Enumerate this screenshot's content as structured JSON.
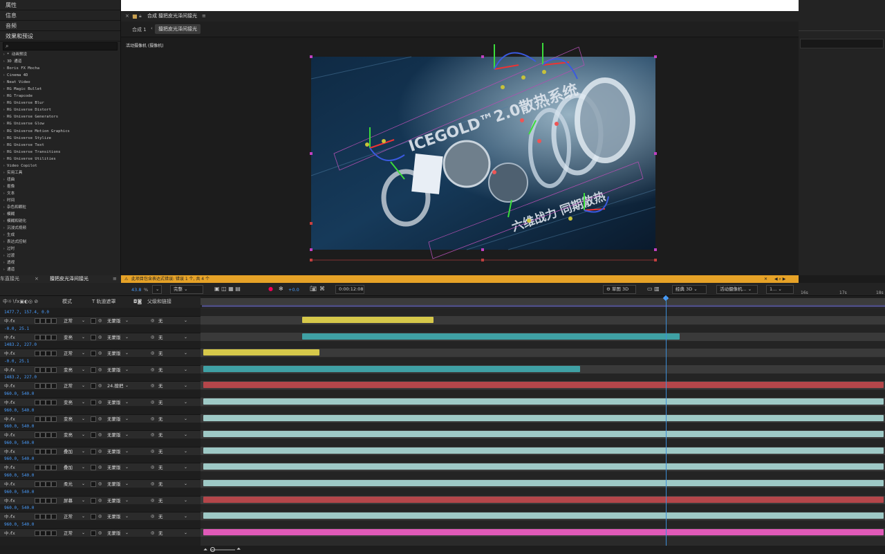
{
  "left_panel": {
    "sections": [
      "属性",
      "信息",
      "音频",
      "效果和预设"
    ],
    "effects": [
      "* 动画预设",
      "3D 通道",
      "Boris FX Mocha",
      "Cinema 4D",
      "Neat Video",
      "RG Magic Bullet",
      "RG Trapcode",
      "RG Universe Blur",
      "RG Universe Distort",
      "RG Universe Generators",
      "RG Universe Glow",
      "RG Universe Motion Graphics",
      "RG Universe Stylize",
      "RG Universe Text",
      "RG Universe Transitions",
      "RG Universe Utilities",
      "Video Copilot",
      "实用工具",
      "扭曲",
      "抠像",
      "文本",
      "时间",
      "杂色和颗粒",
      "模糊",
      "模糊和锐化",
      "沉浸式视频",
      "生成",
      "表达式控制",
      "过时",
      "过渡",
      "透视",
      "通道"
    ]
  },
  "composition": {
    "header_prefix": "合成",
    "name": "擅把皮光泽间接光",
    "breadcrumb_root": "合成 1",
    "breadcrumb_current": "擅把皮光泽间接光",
    "camera_label": "活动摄像机 (摄像机)",
    "scene_title": "ICEGOLD™2.0散热系统",
    "scene_text2": "六维战力 同期散热"
  },
  "warning": "此项目包含表达式错误: 错误 1 个, 共 4 个",
  "timeline": {
    "tab_left": "车直接光",
    "tab_active": "擅把皮光泽间接光",
    "zoom": "43.8",
    "quality": "完整",
    "exposure": "+0.0",
    "timecode": "0:00:12:08",
    "renderer": "草图 3D",
    "view_mode": "经典 3D",
    "camera_menu": "活动摄像机...",
    "views": "1...",
    "col_mode": "模式",
    "col_track": "T 轨道遮罩",
    "col_parent": "父级和链接",
    "ruler_16": "16s",
    "ruler_17": "17s",
    "ruler_18": "18s",
    "layers": [
      {
        "coords": "1477.7, 157.4, 0.0",
        "mode": "正常",
        "track": "无蒙版",
        "parent": "无",
        "bar_start": 0.148,
        "bar_end": 0.34,
        "color": "#d6c84a"
      },
      {
        "coords": "-0.0, 25.1",
        "mode": "变亮",
        "track": "无蒙版",
        "parent": "无",
        "bar_start": 0.148,
        "bar_end": 0.7,
        "color": "#3fa0a4"
      },
      {
        "coords": "1483.2, 227.0",
        "mode": "正常",
        "track": "无蒙版",
        "parent": "无",
        "bar_start": 0.004,
        "bar_end": 0.174,
        "color": "#d6c84a"
      },
      {
        "coords": "-0.0, 25.1",
        "mode": "变亮",
        "track": "无蒙版",
        "parent": "无",
        "bar_start": 0.004,
        "bar_end": 0.555,
        "color": "#3fa0a4"
      },
      {
        "coords": "1483.2, 227.0",
        "mode": "正常",
        "track": "24.擅把",
        "parent": "无",
        "bar_start": 0.004,
        "bar_end": 0.998,
        "color": "#b4464a"
      },
      {
        "coords": "960.0, 540.0",
        "mode": "变亮",
        "track": "无蒙版",
        "parent": "无",
        "bar_start": 0.004,
        "bar_end": 0.998,
        "color": "#9ec9c6"
      },
      {
        "coords": "960.0, 540.0",
        "mode": "变亮",
        "track": "无蒙版",
        "parent": "无",
        "bar_start": 0.004,
        "bar_end": 0.998,
        "color": "#9ec9c6"
      },
      {
        "coords": "960.0, 540.0",
        "mode": "变亮",
        "track": "无蒙版",
        "parent": "无",
        "bar_start": 0.004,
        "bar_end": 0.998,
        "color": "#9ec9c6"
      },
      {
        "coords": "960.0, 540.0",
        "mode": "叠加",
        "track": "无蒙版",
        "parent": "无",
        "bar_start": 0.004,
        "bar_end": 0.998,
        "color": "#9ec9c6"
      },
      {
        "coords": "960.0, 540.0",
        "mode": "叠加",
        "track": "无蒙版",
        "parent": "无",
        "bar_start": 0.004,
        "bar_end": 0.998,
        "color": "#9ec9c6"
      },
      {
        "coords": "960.0, 540.0",
        "mode": "柔光",
        "track": "无蒙版",
        "parent": "无",
        "bar_start": 0.004,
        "bar_end": 0.998,
        "color": "#9ec9c6"
      },
      {
        "coords": "960.0, 540.0",
        "mode": "屏幕",
        "track": "无蒙版",
        "parent": "无",
        "bar_start": 0.004,
        "bar_end": 0.998,
        "color": "#b4464a"
      },
      {
        "coords": "960.0, 540.0",
        "mode": "正常",
        "track": "无蒙版",
        "parent": "无",
        "bar_start": 0.004,
        "bar_end": 0.998,
        "color": "#9ec9c6"
      },
      {
        "coords": "960.0, 540.0",
        "mode": "正常",
        "track": "无蒙版",
        "parent": "无",
        "bar_start": 0.004,
        "bar_end": 0.998,
        "color": "#e05ab8"
      }
    ]
  }
}
